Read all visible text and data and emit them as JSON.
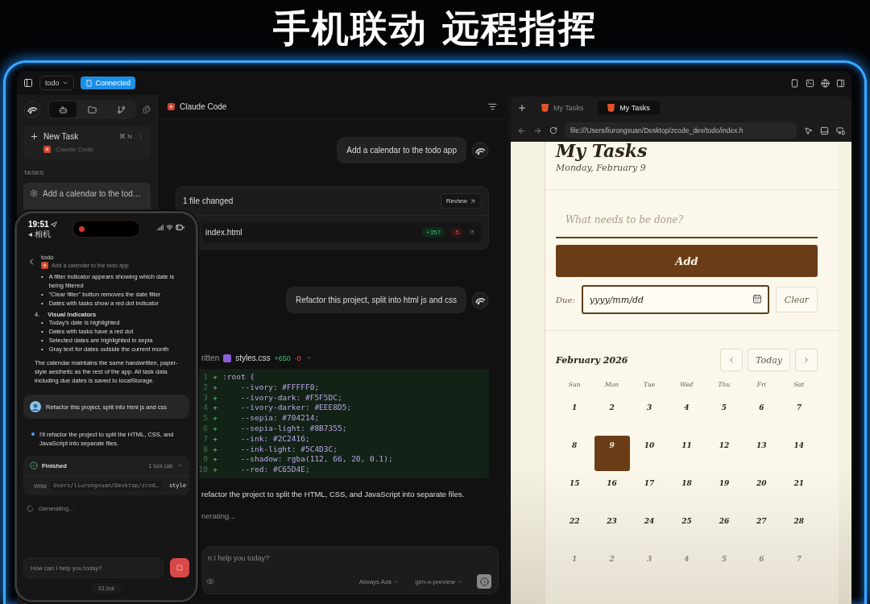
{
  "headline": "手机联动 远程指挥",
  "toolbar": {
    "project": "todo",
    "status": "Connected"
  },
  "sidebar": {
    "tabs": [
      {
        "kind": "agent",
        "selected": true
      },
      {
        "kind": "files",
        "selected": false
      },
      {
        "kind": "git",
        "selected": false
      }
    ],
    "new_task": {
      "label": "New Task",
      "shortcut": "⌘ N",
      "agent": "Claude Code"
    },
    "section": "TASKS",
    "tasks": [
      {
        "title": "Add a calendar to the tod…",
        "selected": true
      }
    ]
  },
  "chat": {
    "agent": "Claude Code",
    "items": [
      {
        "kind": "user",
        "text": "Add a calendar to the todo app"
      },
      {
        "kind": "changes",
        "title": "1 file changed",
        "action": "Review",
        "files": [
          {
            "name": "index.html",
            "added": "+357",
            "removed": "-5"
          }
        ]
      },
      {
        "kind": "user",
        "text": "Refactor this project, split into html js and css"
      },
      {
        "kind": "tool",
        "verb": "ritten",
        "file": "styles.css",
        "added": "+650",
        "removed": "-0",
        "lines": [
          {
            "number": "1",
            "sign": "+",
            "code": ":root {"
          },
          {
            "number": "2",
            "sign": "+",
            "code": "    --ivory: #FFFFF0;"
          },
          {
            "number": "3",
            "sign": "+",
            "code": "    --ivory-dark: #F5F5DC;"
          },
          {
            "number": "4",
            "sign": "+",
            "code": "    --ivory-darker: #EEE8D5;"
          },
          {
            "number": "5",
            "sign": "+",
            "code": "    --sepia: #704214;"
          },
          {
            "number": "6",
            "sign": "+",
            "code": "    --sepia-light: #8B7355;"
          },
          {
            "number": "7",
            "sign": "+",
            "code": "    --ink: #2C2416;"
          },
          {
            "number": "8",
            "sign": "+",
            "code": "    --ink-light: #5C4D3C;"
          },
          {
            "number": "9",
            "sign": "+",
            "code": "    --shadow: rgba(112, 66, 20, 0.1);"
          },
          {
            "number": "10",
            "sign": "+",
            "code": "    --red: #C65D4E;"
          }
        ]
      },
      {
        "kind": "text",
        "text": "refactor the project to split the HTML, CSS, and JavaScript into separate files."
      },
      {
        "kind": "status",
        "text": "nerating..."
      }
    ],
    "input": {
      "placeholder": "n I help you today?",
      "mode": "Always Ask",
      "model": "glm-x-preview"
    }
  },
  "browser": {
    "tabs": [
      {
        "title": "My Tasks",
        "selected": false
      },
      {
        "title": "My Tasks",
        "selected": true
      }
    ],
    "url": "file:///Users/liurongxuan/Desktop/zcode_dev/todo/index.h",
    "page": {
      "heading": "My Tasks",
      "date": "Monday, February 9",
      "task_placeholder": "What needs to be done?",
      "add": "Add",
      "due_label": "Due:",
      "due_value": "yyyy/mm/dd",
      "due_focused": true,
      "clear": "Clear",
      "calendar": {
        "month": "February 2026",
        "today": "Today",
        "weekdays": [
          "Sun",
          "Mon",
          "Tue",
          "Wed",
          "Thu",
          "Fri",
          "Sat"
        ],
        "weeks": [
          [
            {
              "day": "1",
              "selected": false,
              "muted": false
            },
            {
              "day": "2",
              "selected": false,
              "muted": false
            },
            {
              "day": "3",
              "selected": false,
              "muted": false
            },
            {
              "day": "4",
              "selected": false,
              "muted": false
            },
            {
              "day": "5",
              "selected": false,
              "muted": false
            },
            {
              "day": "6",
              "selected": false,
              "muted": false
            },
            {
              "day": "7",
              "selected": false,
              "muted": false
            }
          ],
          [
            {
              "day": "8",
              "selected": false,
              "muted": false
            },
            {
              "day": "9",
              "selected": true,
              "muted": false
            },
            {
              "day": "10",
              "selected": false,
              "muted": false
            },
            {
              "day": "11",
              "selected": false,
              "muted": false
            },
            {
              "day": "12",
              "selected": false,
              "muted": false
            },
            {
              "day": "13",
              "selected": false,
              "muted": false
            },
            {
              "day": "14",
              "selected": false,
              "muted": false
            }
          ],
          [
            {
              "day": "15",
              "selected": false,
              "muted": false
            },
            {
              "day": "16",
              "selected": false,
              "muted": false
            },
            {
              "day": "17",
              "selected": false,
              "muted": false
            },
            {
              "day": "18",
              "selected": false,
              "muted": false
            },
            {
              "day": "19",
              "selected": false,
              "muted": false
            },
            {
              "day": "20",
              "selected": false,
              "muted": false
            },
            {
              "day": "21",
              "selected": false,
              "muted": false
            }
          ],
          [
            {
              "day": "22",
              "selected": false,
              "muted": false
            },
            {
              "day": "23",
              "selected": false,
              "muted": false
            },
            {
              "day": "24",
              "selected": false,
              "muted": false
            },
            {
              "day": "25",
              "selected": false,
              "muted": false
            },
            {
              "day": "26",
              "selected": false,
              "muted": false
            },
            {
              "day": "27",
              "selected": false,
              "muted": false
            },
            {
              "day": "28",
              "selected": false,
              "muted": false
            }
          ],
          [
            {
              "day": "1",
              "selected": false,
              "muted": true
            },
            {
              "day": "2",
              "selected": false,
              "muted": true
            },
            {
              "day": "3",
              "selected": false,
              "muted": true
            },
            {
              "day": "4",
              "selected": false,
              "muted": true
            },
            {
              "day": "5",
              "selected": false,
              "muted": true
            },
            {
              "day": "6",
              "selected": false,
              "muted": true
            },
            {
              "day": "7",
              "selected": false,
              "muted": true
            }
          ]
        ]
      }
    }
  },
  "phone": {
    "time": "19:51",
    "back_app": "◂ 相机",
    "title": "todo",
    "subtitle": "Add a calendar to the todo app",
    "items": [
      {
        "kind": "bullets",
        "marker": "•",
        "items": [
          "A filter indicator appears showing which date is being filtered",
          "\"Clear filter\" button removes the date filter",
          "Dates with tasks show a red dot indicator"
        ]
      },
      {
        "kind": "heading",
        "number": "4.",
        "text": "Visual Indicators"
      },
      {
        "kind": "bullets",
        "marker": "•",
        "items": [
          "Today's date is highlighted",
          "Dates with tasks have a red dot",
          "Selected dates are highlighted in sepia",
          "Gray text for dates outside the current month"
        ]
      },
      {
        "kind": "paragraph",
        "text": "The calendar maintains the same handwritten, paper-style aesthetic as the rest of the app. All task data including due dates is saved to localStorage."
      },
      {
        "kind": "user",
        "text": "Refactor this project, split into html js and css"
      },
      {
        "kind": "assistant",
        "text": "I'll refactor the project to split the HTML, CSS, and JavaScript into separate files."
      },
      {
        "kind": "tool",
        "status": "Finished",
        "count": "1 tool call",
        "action": "Write",
        "path": "Users/liurongxuan/Desktop/zcod…",
        "file": "style"
      },
      {
        "kind": "status",
        "text": "Generating..."
      }
    ],
    "input": {
      "placeholder": "How can I help you today?"
    },
    "home": "01.bot"
  }
}
